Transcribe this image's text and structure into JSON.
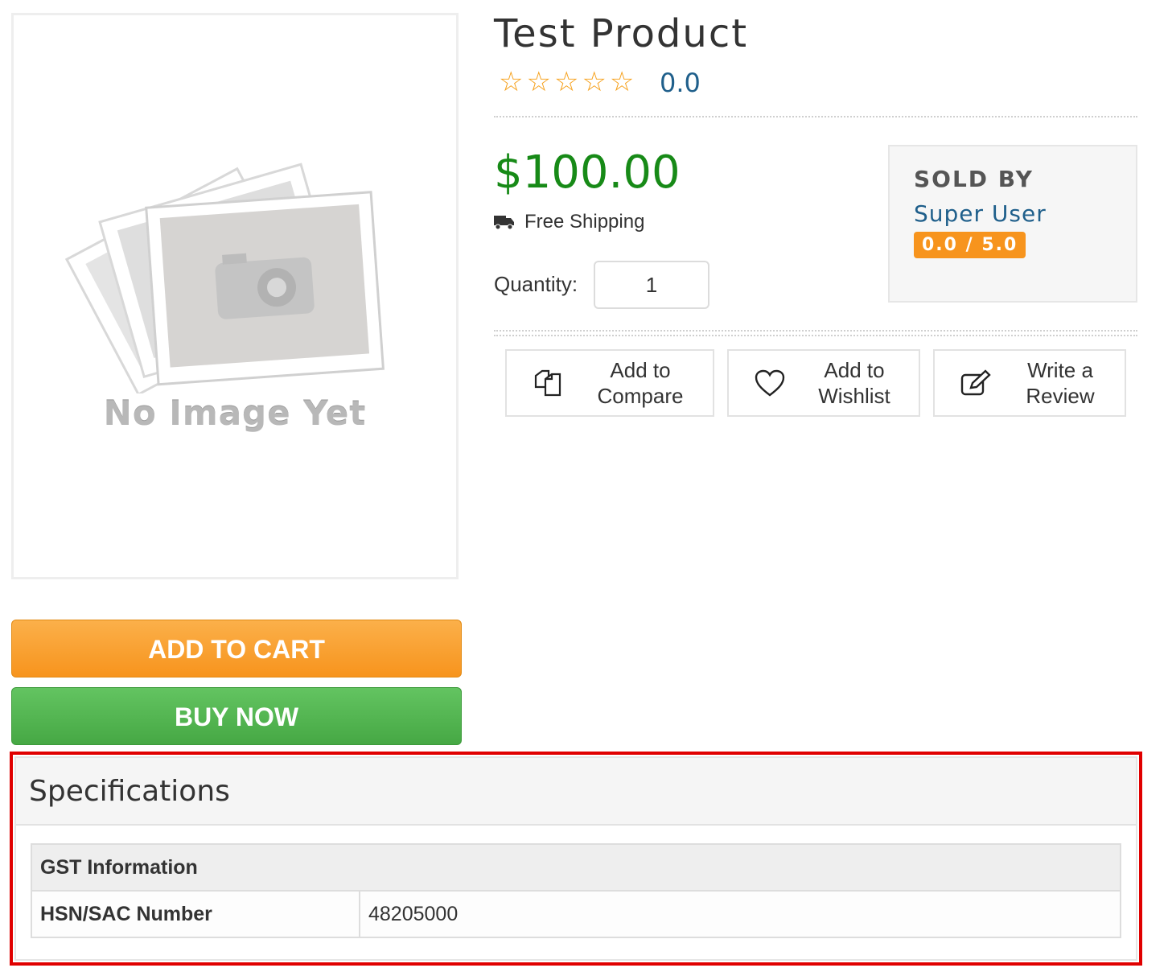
{
  "product": {
    "title": "Test Product",
    "rating_value": "0.0",
    "stars": "☆☆☆☆☆",
    "price": "$100.00",
    "shipping": "Free Shipping",
    "quantity_label": "Quantity:",
    "quantity_value": "1",
    "no_image_text": "No Image Yet"
  },
  "seller": {
    "label": "SOLD BY",
    "name": "Super User",
    "rating": "0.0 / 5.0"
  },
  "actions": {
    "compare_line1": "Add to",
    "compare_line2": "Compare",
    "wishlist_line1": "Add to",
    "wishlist_line2": "Wishlist",
    "review_line1": "Write a",
    "review_line2": "Review"
  },
  "buttons": {
    "add_to_cart": "ADD TO CART",
    "buy_now": "BUY NOW"
  },
  "specifications": {
    "title": "Specifications",
    "group": "GST Information",
    "rows": [
      {
        "key": "HSN/SAC Number",
        "value": "48205000"
      }
    ]
  },
  "colors": {
    "price": "#178a17",
    "accent_orange": "#f7941d",
    "accent_green": "#46a844",
    "link_blue": "#1f5f8b",
    "highlight_red": "#e00000"
  }
}
